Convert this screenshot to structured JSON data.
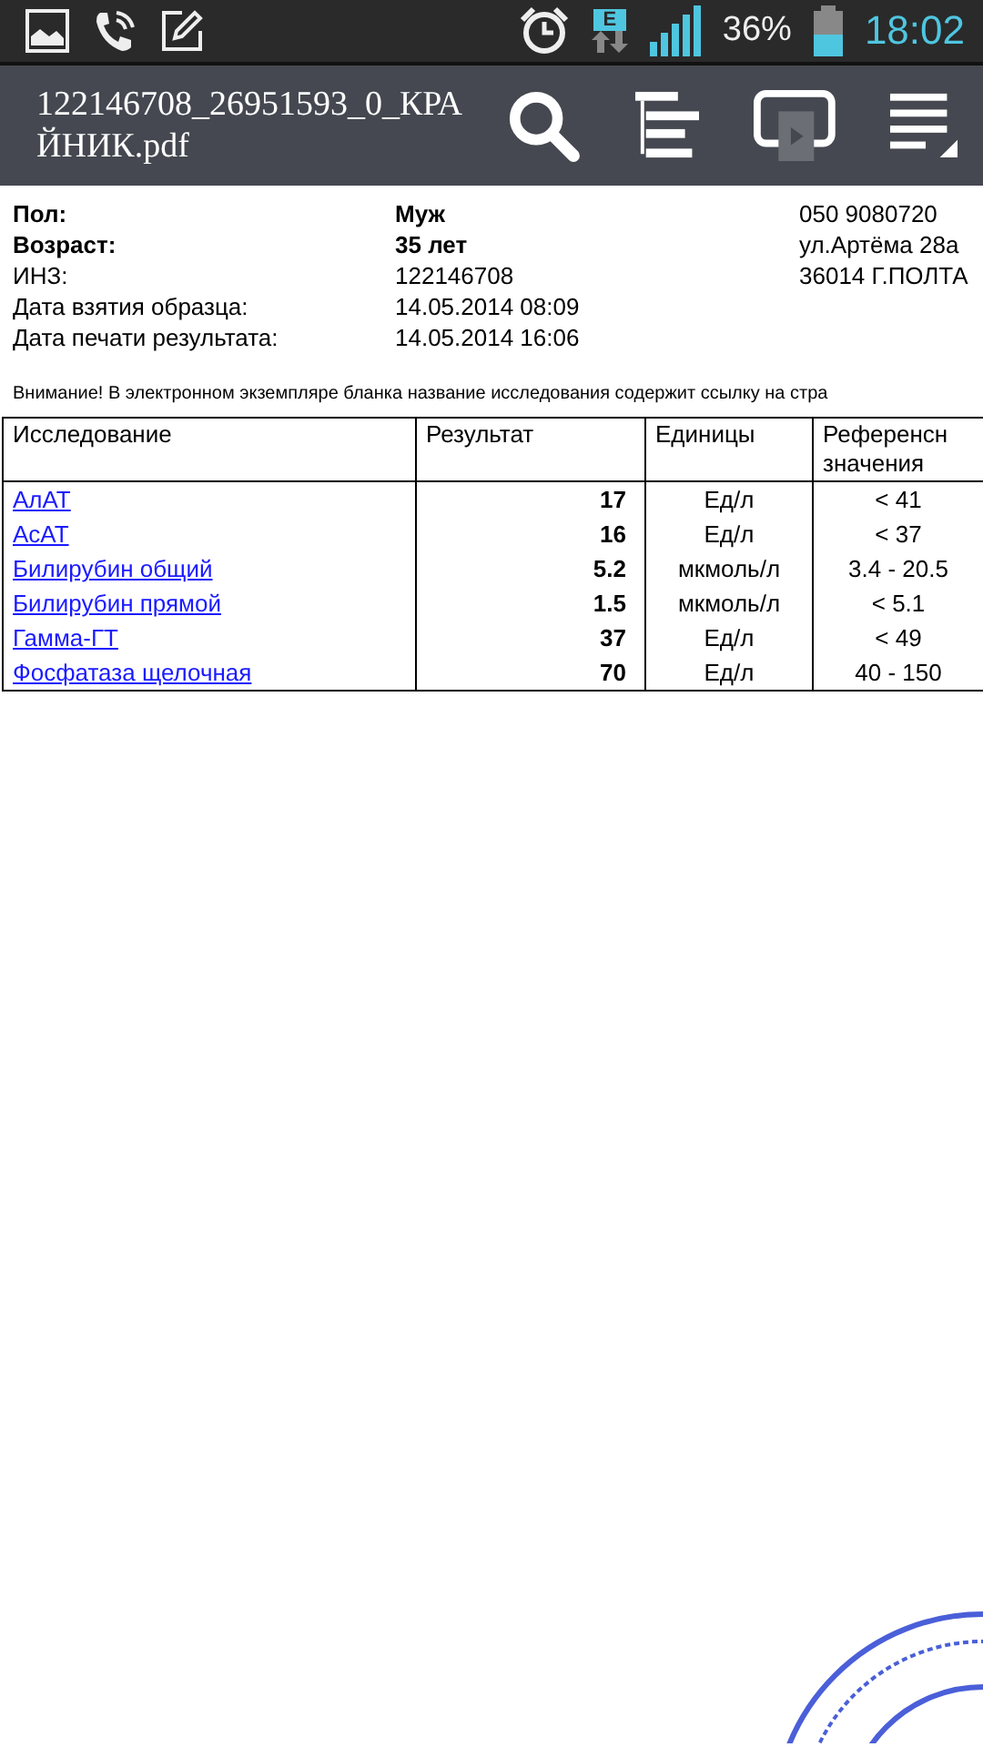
{
  "status_bar": {
    "battery_text": "36%",
    "time": "18:02",
    "network_badge": "E"
  },
  "app_bar": {
    "title": "122146708_26951593_0_КРАЙНИК.pdf"
  },
  "patient_info": [
    {
      "label": "Пол:",
      "value": "Муж",
      "right": "050 9080720",
      "emphasized": true
    },
    {
      "label": "Возраст:",
      "value": "35 лет",
      "right": "ул.Артёма 28а",
      "emphasized": true
    },
    {
      "label": "ИНЗ:",
      "value": "122146708",
      "right": "36014 Г.ПОЛТА",
      "emphasized": false
    },
    {
      "label": "Дата взятия образца:",
      "value": "14.05.2014 08:09",
      "emphasized": false
    },
    {
      "label": "Дата печати результата:",
      "value": "14.05.2014 16:06",
      "emphasized": false
    }
  ],
  "notice": "Внимание! В электронном экземпляре бланка название исследования содержит ссылку на стра",
  "table": {
    "columns": [
      "Исследование",
      "Результат",
      "Единицы",
      "Референсн значения"
    ],
    "rows": [
      [
        "АлАТ",
        "17",
        "Ед/л",
        "< 41"
      ],
      [
        "АсАТ",
        "16",
        "Ед/л",
        "< 37"
      ],
      [
        "Билирубин общий",
        "5.2",
        "мкмоль/л",
        "3.4 - 20.5"
      ],
      [
        "Билирубин прямой",
        "1.5",
        "мкмоль/л",
        "< 5.1"
      ],
      [
        "Гамма-ГТ",
        "37",
        "Ед/л",
        "< 49"
      ],
      [
        "Фосфатаза щелочная",
        "70",
        "Ед/л",
        "40 - 150"
      ]
    ]
  }
}
